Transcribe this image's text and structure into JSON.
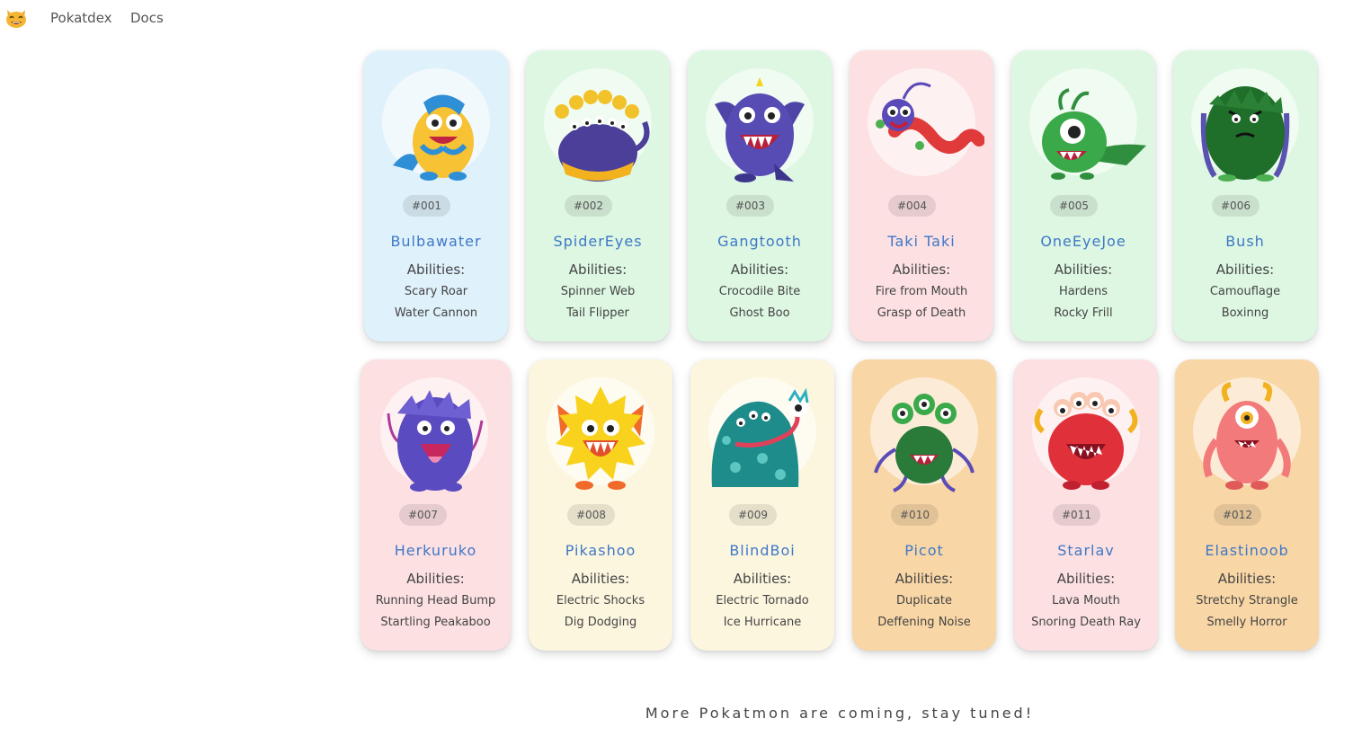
{
  "nav": {
    "logo_icon": "smiling-cat-face-icon",
    "brand": "Pokatdex",
    "docs": "Docs"
  },
  "colors": {
    "blue": "#dff1fb",
    "green": "#ddf7e2",
    "pink": "#fce0e2",
    "cream": "#fcf6df",
    "orange": "#f8d6a6",
    "name": "#3f78c7"
  },
  "abilities_label": "Abilities:",
  "cards": [
    {
      "id": "#001",
      "name": "Bulbawater",
      "abilities": [
        "Scary Roar",
        "Water Cannon"
      ],
      "color": "blue",
      "icon": "blue-yellow-monster-icon"
    },
    {
      "id": "#002",
      "name": "SpiderEyes",
      "abilities": [
        "Spinner Web",
        "Tail Flipper"
      ],
      "color": "green",
      "icon": "many-eyed-purple-monster-icon"
    },
    {
      "id": "#003",
      "name": "Gangtooth",
      "abilities": [
        "Crocodile Bite",
        "Ghost Boo"
      ],
      "color": "green",
      "icon": "purple-winged-monster-icon"
    },
    {
      "id": "#004",
      "name": "Taki Taki",
      "abilities": [
        "Fire from Mouth",
        "Grasp of Death"
      ],
      "color": "pink",
      "icon": "red-dragon-monster-icon"
    },
    {
      "id": "#005",
      "name": "OneEyeJoe",
      "abilities": [
        "Hardens",
        "Rocky Frill"
      ],
      "color": "green",
      "icon": "green-one-eyed-monster-icon"
    },
    {
      "id": "#006",
      "name": "Bush",
      "abilities": [
        "Camouflage",
        "Boxinng"
      ],
      "color": "green",
      "icon": "green-furry-monster-icon"
    },
    {
      "id": "#007",
      "name": "Herkuruko",
      "abilities": [
        "Running Head Bump",
        "Startling Peakaboo"
      ],
      "color": "pink",
      "icon": "purple-furry-monster-icon"
    },
    {
      "id": "#008",
      "name": "Pikashoo",
      "abilities": [
        "Electric Shocks",
        "Dig Dodging"
      ],
      "color": "cream",
      "icon": "yellow-spiky-monster-icon"
    },
    {
      "id": "#009",
      "name": "BlindBoi",
      "abilities": [
        "Electric Tornado",
        "Ice Hurricane"
      ],
      "color": "cream",
      "icon": "teal-blob-monster-icon"
    },
    {
      "id": "#010",
      "name": "Picot",
      "abilities": [
        "Duplicate",
        "Deffening Noise"
      ],
      "color": "orange",
      "icon": "green-three-eyed-monster-icon"
    },
    {
      "id": "#011",
      "name": "Starlav",
      "abilities": [
        "Lava Mouth",
        "Snoring Death Ray"
      ],
      "color": "pink",
      "icon": "red-four-eyed-monster-icon"
    },
    {
      "id": "#012",
      "name": "Elastinoob",
      "abilities": [
        "Stretchy Strangle",
        "Smelly Horror"
      ],
      "color": "orange",
      "icon": "pink-one-eyed-monster-icon"
    }
  ],
  "footer": "More Pokatmon are coming, stay tuned!"
}
